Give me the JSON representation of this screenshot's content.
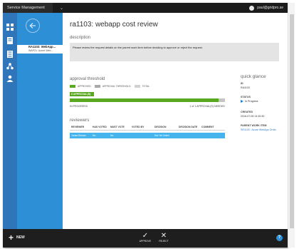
{
  "header": {
    "portal_title": "Service Management Portal",
    "chevron": "⌄",
    "user_email": "paul@gridpro.se",
    "user_icon": "user-circle-icon"
  },
  "rail": {
    "icons": [
      "grid-icon",
      "document-icon",
      "list-icon",
      "network-icon",
      "person-icon"
    ]
  },
  "nav": {
    "back_icon": "arrow-left-icon",
    "items": [
      {
        "title": "RA1103: WebApp...",
        "subtitle": "WAP21: Azure Web...",
        "active": true
      }
    ]
  },
  "main": {
    "title": "ra1103: webapp cost review",
    "description_label": "description",
    "description_text": "Please review the request details on the parent work item before deciding to approve or reject the request.",
    "threshold_label": "approval threshold",
    "legend": [
      {
        "label": "APPROVED",
        "color": "#5aa820"
      },
      {
        "label": "APPROVAL THRESHOLD",
        "color": "#a9a9a9"
      },
      {
        "label": "TOTAL",
        "color": "#d0d0d0"
      }
    ],
    "approvals_badge": "0 APPROVAL(S)",
    "progress_status": "IN PROGRESS",
    "progress_count": "1 of 1 APPROVAL(S) NEEDED",
    "progress_fraction": 0.96,
    "reviewers_label": "reviewers",
    "table": {
      "headers": [
        "REVIEWER",
        "HAS VOTED",
        "MUST VOTE",
        "VOTED BY",
        "DECISION",
        "DECISION DATE",
        "COMMENT"
      ],
      "rows": [
        [
          "Jonas Ekman",
          "No",
          "No",
          "",
          "Not Yet Voted",
          "",
          ""
        ]
      ]
    }
  },
  "quick_glance": {
    "title": "quick glance",
    "id_label": "ID",
    "id_value": "RA1103",
    "status_label": "STATUS",
    "status_value": "In Progress",
    "created_label": "CREATED",
    "created_value": "2016-07-05 14:30:30",
    "parent_label": "PARENT WORK ITEM",
    "parent_value": "SR1100 : Azure WebApp Order"
  },
  "bottom": {
    "new_label": "NEW",
    "approve_label": "APPROVE",
    "reject_label": "REJECT",
    "help_label": "?"
  },
  "colors": {
    "rail": "#2f75ba",
    "nav": "#2d8fd6",
    "accent_green": "#5aa820",
    "row_highlight": "#46b4ec"
  }
}
